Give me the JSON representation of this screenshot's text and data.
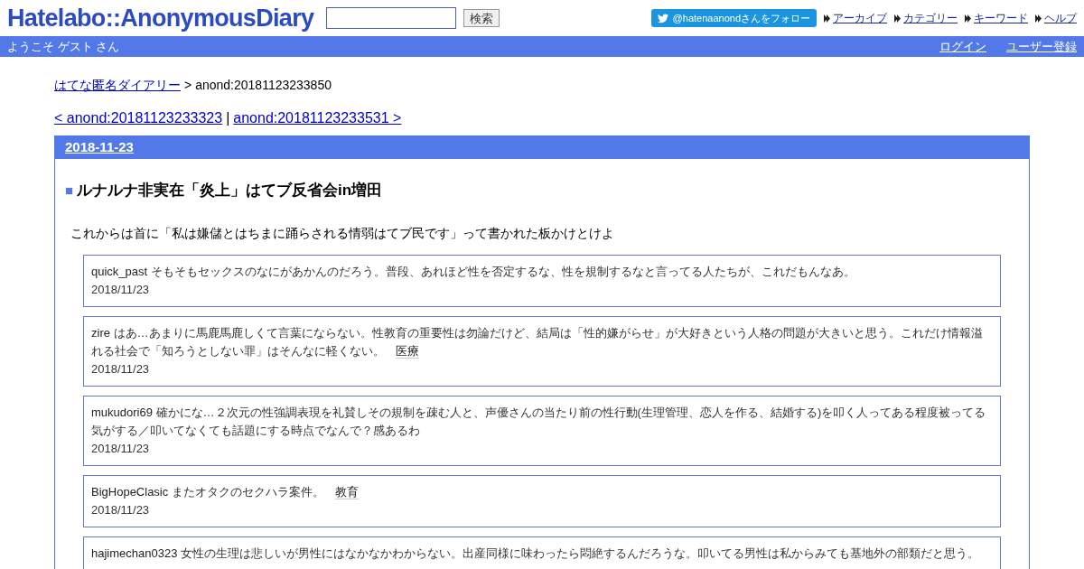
{
  "header": {
    "logo": "Hatelabo::AnonymousDiary",
    "search": {
      "button": "検索"
    },
    "follow_button": "@hatenaanondさんをフォロー",
    "links": [
      "アーカイブ",
      "カテゴリー",
      "キーワード",
      "ヘルプ"
    ]
  },
  "user_bar": {
    "welcome": "ようこそ ゲスト さん",
    "links": [
      "ログイン",
      "ユーザー登録"
    ]
  },
  "breadcrumb": {
    "home": "はてな匿名ダイアリー",
    "separator": ">",
    "current": "anond:20181123233850"
  },
  "entry_nav": {
    "prev": "< anond:20181123233323",
    "separator": "|",
    "next": "anond:20181123233531 >"
  },
  "day": {
    "date": "2018-11-23",
    "title_mark": "■",
    "title": "ルナルナ非実在「炎上」はてブ反省会in増田",
    "body": "これからは首に「私は嫌儲とはちまに踊らされる情弱はてブ民です」って書かれた板かけとけよ",
    "comments": [
      {
        "user": "quick_past",
        "text": "そもそもセックスのなにがあかんのだろう。普段、あれほど性を否定するな、性を規制するなと言ってる人たちが、これだもんなあ。",
        "date": "2018/11/23"
      },
      {
        "user": "zire",
        "text": "はあ…あまりに馬鹿馬鹿しくて言葉にならない。性教育の重要性は勿論だけど、結局は「性的嫌がらせ」が大好きという人格の問題が大きいと思う。これだけ情報溢れる社会で「知ろうとしない罪」はそんなに軽くない。",
        "tag": "医療",
        "date": "2018/11/23"
      },
      {
        "user": "mukudori69",
        "text": "確かにな…２次元の性強調表現を礼賛しその規制を疎む人と、声優さんの当たり前の性行動(生理管理、恋人を作る、結婚する)を叩く人ってある程度被ってる気がする／叩いてなくても話題にする時点でなんで？感あるわ",
        "date": "2018/11/23"
      },
      {
        "user": "BigHopeClasic",
        "text": "またオタクのセクハラ案件。",
        "tag": "教育",
        "date": "2018/11/23"
      },
      {
        "user": "hajimechan0323",
        "text": "女性の生理は悲しいが男性にはなかなかわからない。出産同様に味わったら悶絶するんだろうな。叩いてる男性は私からみても基地外の部類だと思う。"
      }
    ]
  }
}
